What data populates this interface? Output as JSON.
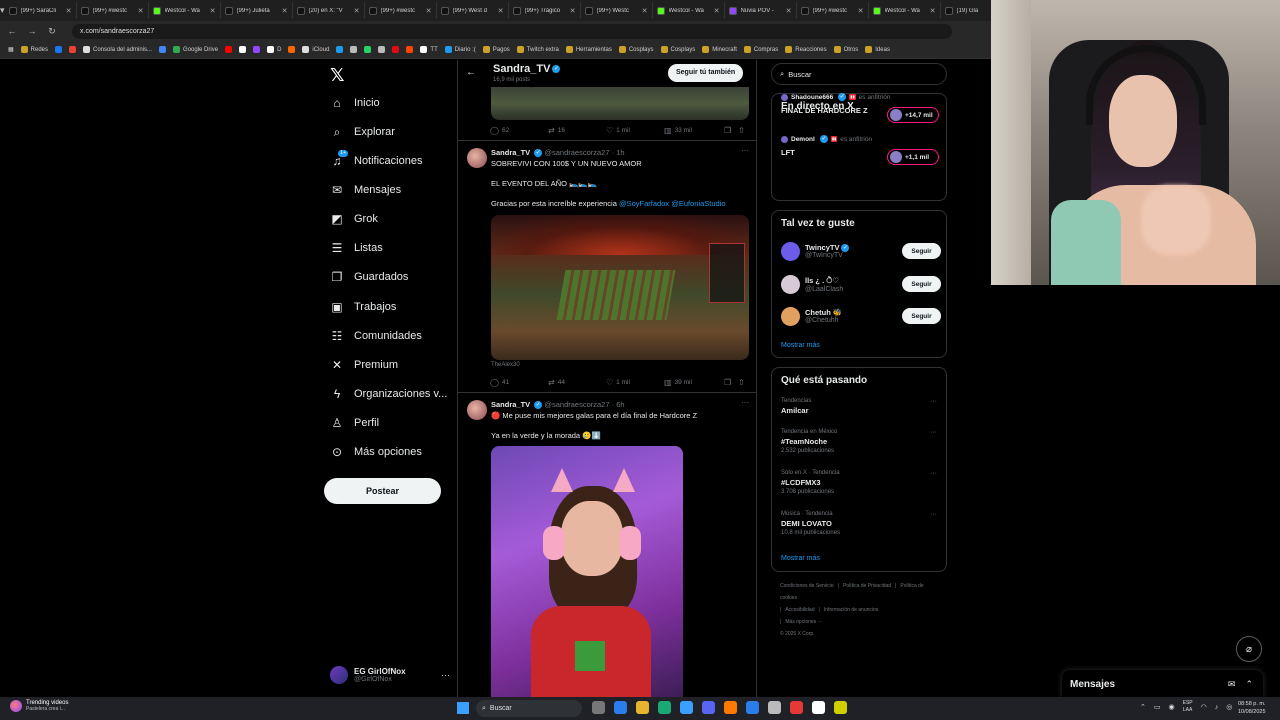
{
  "browser": {
    "tabs": [
      {
        "title": "(99+) SaraCli",
        "icon_color": "#111111"
      },
      {
        "title": "(99+) #westc",
        "icon_color": "#111111"
      },
      {
        "title": "Westcol - Wa",
        "icon_color": "#53fc18"
      },
      {
        "title": "(99+) Julieta",
        "icon_color": "#111111"
      },
      {
        "title": "(20) en X: \"V",
        "icon_color": "#111111"
      },
      {
        "title": "(99+) #westc",
        "icon_color": "#111111"
      },
      {
        "title": "(99+) West d",
        "icon_color": "#111111"
      },
      {
        "title": "(99+) Trágico",
        "icon_color": "#111111"
      },
      {
        "title": "(99+) Westc",
        "icon_color": "#111111"
      },
      {
        "title": "Westcol - Wa",
        "icon_color": "#53fc18"
      },
      {
        "title": "Nuvia POV -",
        "icon_color": "#9146ff"
      },
      {
        "title": "(99+) #westc",
        "icon_color": "#111111"
      },
      {
        "title": "Westcol - Wa",
        "icon_color": "#53fc18"
      },
      {
        "title": "(19) Gla",
        "icon_color": "#111111"
      }
    ],
    "url": "x.com/sandraescorza27",
    "bookmarks": [
      {
        "label": "Redes",
        "color": "#c9a227"
      },
      {
        "label": "",
        "color": "#1877f2"
      },
      {
        "label": "",
        "color": "#ea4335"
      },
      {
        "label": "Consola del adminis...",
        "color": "#dddddd"
      },
      {
        "label": "",
        "color": "#4285f4"
      },
      {
        "label": "Google Drive",
        "color": "#34a853"
      },
      {
        "label": "",
        "color": "#ff0000"
      },
      {
        "label": "",
        "color": "#ffffff"
      },
      {
        "label": "",
        "color": "#9146ff"
      },
      {
        "label": "D",
        "color": "#ffffff"
      },
      {
        "label": "",
        "color": "#ff6600"
      },
      {
        "label": "iCloud",
        "color": "#dddddd"
      },
      {
        "label": "",
        "color": "#1d9bf0"
      },
      {
        "label": "",
        "color": "#bbbbbb"
      },
      {
        "label": "",
        "color": "#25d366"
      },
      {
        "label": "",
        "color": "#bbbbbb"
      },
      {
        "label": "",
        "color": "#e50914"
      },
      {
        "label": "",
        "color": "#ff4500"
      },
      {
        "label": "TT",
        "color": "#ffffff"
      },
      {
        "label": "Diario :(",
        "color": "#1d9bf0"
      },
      {
        "label": "Pagos",
        "color": "#c9a227"
      },
      {
        "label": "Twitch extra",
        "color": "#c9a227"
      },
      {
        "label": "Herramientas",
        "color": "#c9a227"
      },
      {
        "label": "Cosplays",
        "color": "#c9a227"
      },
      {
        "label": "Cosplays",
        "color": "#c9a227"
      },
      {
        "label": "Minecraft",
        "color": "#c9a227"
      },
      {
        "label": "Compras",
        "color": "#c9a227"
      },
      {
        "label": "Reacciones",
        "color": "#c9a227"
      },
      {
        "label": "Otros",
        "color": "#c9a227"
      },
      {
        "label": "Ideas",
        "color": "#c9a227"
      }
    ]
  },
  "nav": {
    "items": [
      {
        "label": "Inicio",
        "icon": "home-icon",
        "glyph": "⌂",
        "badge": ""
      },
      {
        "label": "Explorar",
        "icon": "search-icon",
        "glyph": "⌕",
        "badge": ""
      },
      {
        "label": "Notificaciones",
        "icon": "bell-icon",
        "glyph": "♫",
        "badge": "1+"
      },
      {
        "label": "Mensajes",
        "icon": "mail-icon",
        "glyph": "✉",
        "badge": ""
      },
      {
        "label": "Grok",
        "icon": "grok-icon",
        "glyph": "◩",
        "badge": ""
      },
      {
        "label": "Listas",
        "icon": "list-icon",
        "glyph": "☰",
        "badge": ""
      },
      {
        "label": "Guardados",
        "icon": "bookmark-icon",
        "glyph": "❐",
        "badge": ""
      },
      {
        "label": "Trabajos",
        "icon": "briefcase-icon",
        "glyph": "▣",
        "badge": ""
      },
      {
        "label": "Comunidades",
        "icon": "people-icon",
        "glyph": "☷",
        "badge": ""
      },
      {
        "label": "Premium",
        "icon": "x-premium-icon",
        "glyph": "✕",
        "badge": ""
      },
      {
        "label": "Organizaciones v...",
        "icon": "lightning-icon",
        "glyph": "ϟ",
        "badge": ""
      },
      {
        "label": "Perfil",
        "icon": "person-icon",
        "glyph": "♙",
        "badge": ""
      },
      {
        "label": "Más opciones",
        "icon": "more-circle-icon",
        "glyph": "⊙",
        "badge": ""
      }
    ],
    "post_label": "Postear",
    "account_name": "EG GirlOfNox",
    "account_handle": "@GirlOfNox"
  },
  "profile": {
    "name": "Sandra_TV",
    "posts": "16,9 mil posts",
    "follow_label": "Seguir tú también"
  },
  "tweets": [
    {
      "replies": "62",
      "retweets": "16",
      "likes": "1 mil",
      "views": "33 mil"
    },
    {
      "author": "Sandra_TV",
      "handle": "@sandraescorza27",
      "time": "· 1h",
      "line1": "SOBREVIVI CON 100$ Y UN NUEVO AMOR",
      "line2": "EL EVENTO DEL AÑO 🛌🛌🛌",
      "line3_prefix": "Gracias por esta increíble experiencia",
      "mention1": "@SoyFarfadox",
      "mention2": "@EufoniaStudio",
      "media_credit": "TheAlex30",
      "replies": "41",
      "retweets": "44",
      "likes": "1 mil",
      "views": "39 mil"
    },
    {
      "author": "Sandra_TV",
      "handle": "@sandraescorza27",
      "time": "· 6h",
      "line1": "🔴 Me puse mis mejores galas para el día final de Hardcore Z",
      "line2": "Ya en la verde y la morada 🥲⬇️"
    }
  ],
  "sidebar": {
    "search_placeholder": "Buscar",
    "live_title": "En directo en X",
    "live": [
      {
        "host": "Shadoune666",
        "tag": "es anfitrión",
        "title": "FINAL DE HARDCORE Z",
        "count": "+14,7 mil"
      },
      {
        "host": "Demonl",
        "tag": "es anfitrión",
        "title": "LFT",
        "count": "+1,1 mil"
      }
    ],
    "suggest_title": "Tal vez te guste",
    "suggestions": [
      {
        "name": "TwincyTV",
        "handle": "@TwIncyTV",
        "button": "Seguir",
        "color": "#6c5ce7",
        "verified": true
      },
      {
        "name": "lls ¿ . ੈ♡",
        "handle": "@LaalClash",
        "button": "Seguir",
        "color": "#d8c9d6",
        "verified": false
      },
      {
        "name": "Chetuh 🐝",
        "handle": "@Chetuhh",
        "button": "Seguir",
        "color": "#e0a060",
        "verified": false
      }
    ],
    "show_more": "Mostrar más",
    "trends_title": "Qué está pasando",
    "trends": [
      {
        "context": "Tendencias",
        "name": "Amilcar",
        "count": ""
      },
      {
        "context": "Tendencia en México",
        "name": "#TeamNoche",
        "count": "2.532 publicaciones"
      },
      {
        "context": "Solo en X · Tendencia",
        "name": "#LCDFMX3",
        "count": "3.708 publicaciones"
      },
      {
        "context": "Música · Tendencia",
        "name": "DEMI LOVATO",
        "count": "10,8 mil publicaciones"
      }
    ],
    "trends_more": "Mostrar más",
    "footer": [
      "Condiciones de Servicio",
      "|",
      "Política de Privacidad",
      "|",
      "Política de cookies",
      "|",
      "Accesibilidad",
      "|",
      "Información de anuncios",
      "|",
      "Más opciones ···",
      "© 2025 X Corp."
    ]
  },
  "messages": {
    "title": "Mensajes"
  },
  "taskbar": {
    "weather_title": "Trending videos",
    "weather_sub": "Pastelera crea i...",
    "search_label": "Buscar",
    "lang_top": "ESP",
    "lang_bottom": "LAA",
    "time": "08:58 p. m.",
    "date": "10/08/2025",
    "app_colors": [
      "#777777",
      "#2b7de9",
      "#e8b430",
      "#19a974",
      "#3aa0ff",
      "#5865f2",
      "#ff7a00",
      "#2b7de9",
      "#bbbbbb",
      "#e53935",
      "#ffffff",
      "#d0d000"
    ]
  }
}
